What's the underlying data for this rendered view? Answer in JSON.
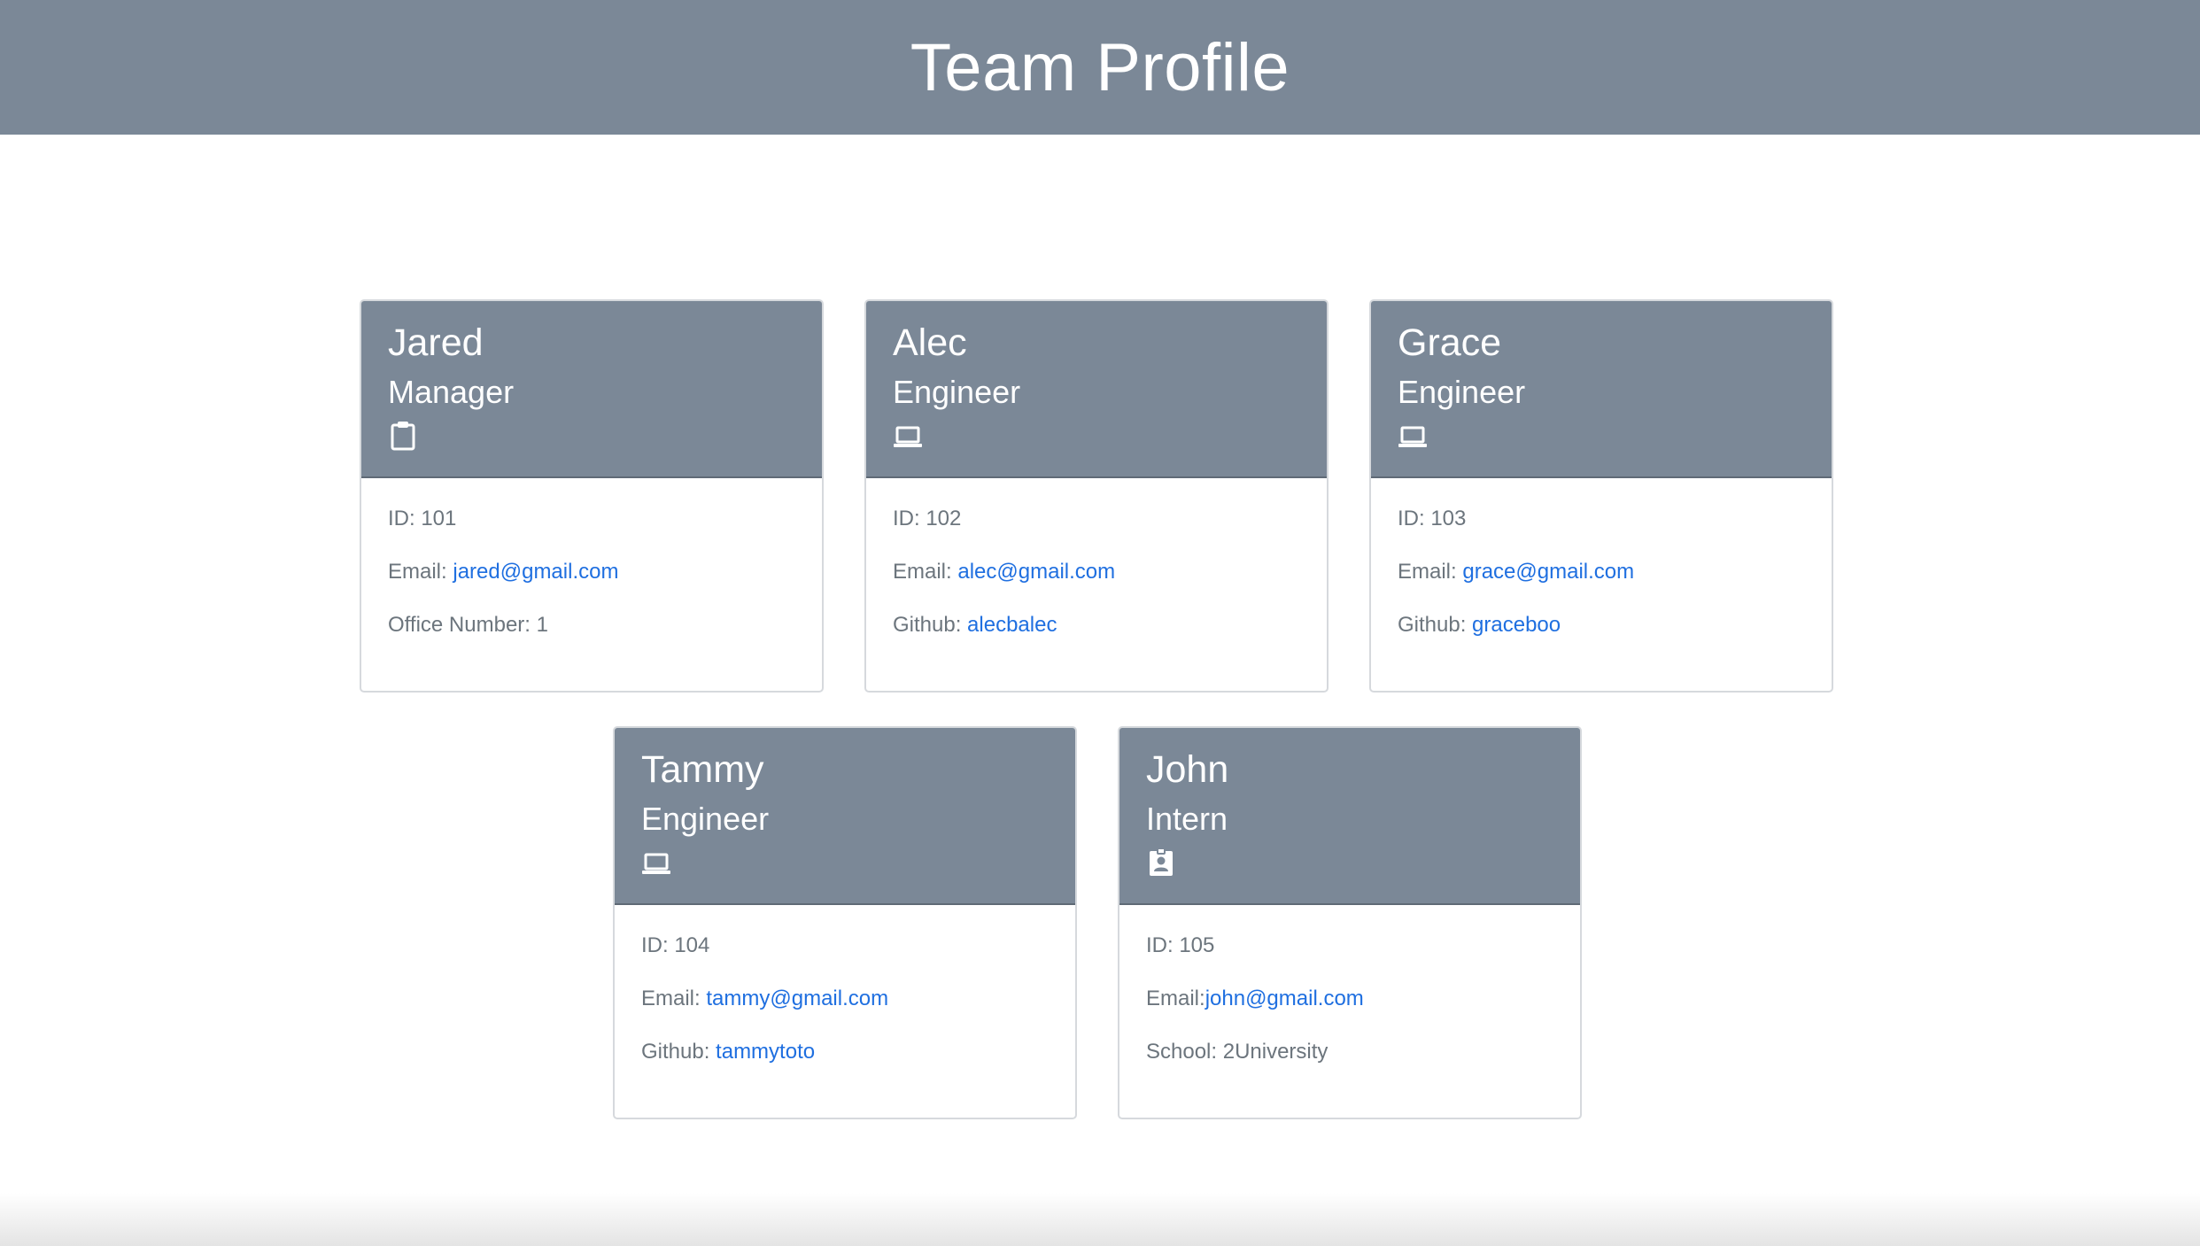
{
  "page": {
    "title": "Team Profile"
  },
  "colors": {
    "header_bg": "#7b8897",
    "link": "#1f6fe0",
    "muted_text": "#6c757d"
  },
  "members": [
    {
      "name": "Jared",
      "role": "Manager",
      "icon": "clipboard-icon",
      "id_label": "ID: 101",
      "email_label": "Email: ",
      "email": "jared@gmail.com",
      "extra_label": "Office Number: 1",
      "extra_link": ""
    },
    {
      "name": "Alec",
      "role": "Engineer",
      "icon": "laptop-icon",
      "id_label": "ID: 102",
      "email_label": "Email: ",
      "email": "alec@gmail.com",
      "extra_label": "Github: ",
      "extra_link": "alecbalec"
    },
    {
      "name": "Grace",
      "role": "Engineer",
      "icon": "laptop-icon",
      "id_label": "ID: 103",
      "email_label": "Email: ",
      "email": "grace@gmail.com",
      "extra_label": "Github: ",
      "extra_link": "graceboo"
    },
    {
      "name": "Tammy",
      "role": "Engineer",
      "icon": "laptop-icon",
      "id_label": "ID: 104",
      "email_label": "Email: ",
      "email": "tammy@gmail.com",
      "extra_label": "Github: ",
      "extra_link": "tammytoto"
    },
    {
      "name": "John",
      "role": "Intern",
      "icon": "id-badge-icon",
      "id_label": "ID: 105",
      "email_label": "Email:",
      "email": "john@gmail.com",
      "extra_label": "School: 2University",
      "extra_link": ""
    }
  ]
}
